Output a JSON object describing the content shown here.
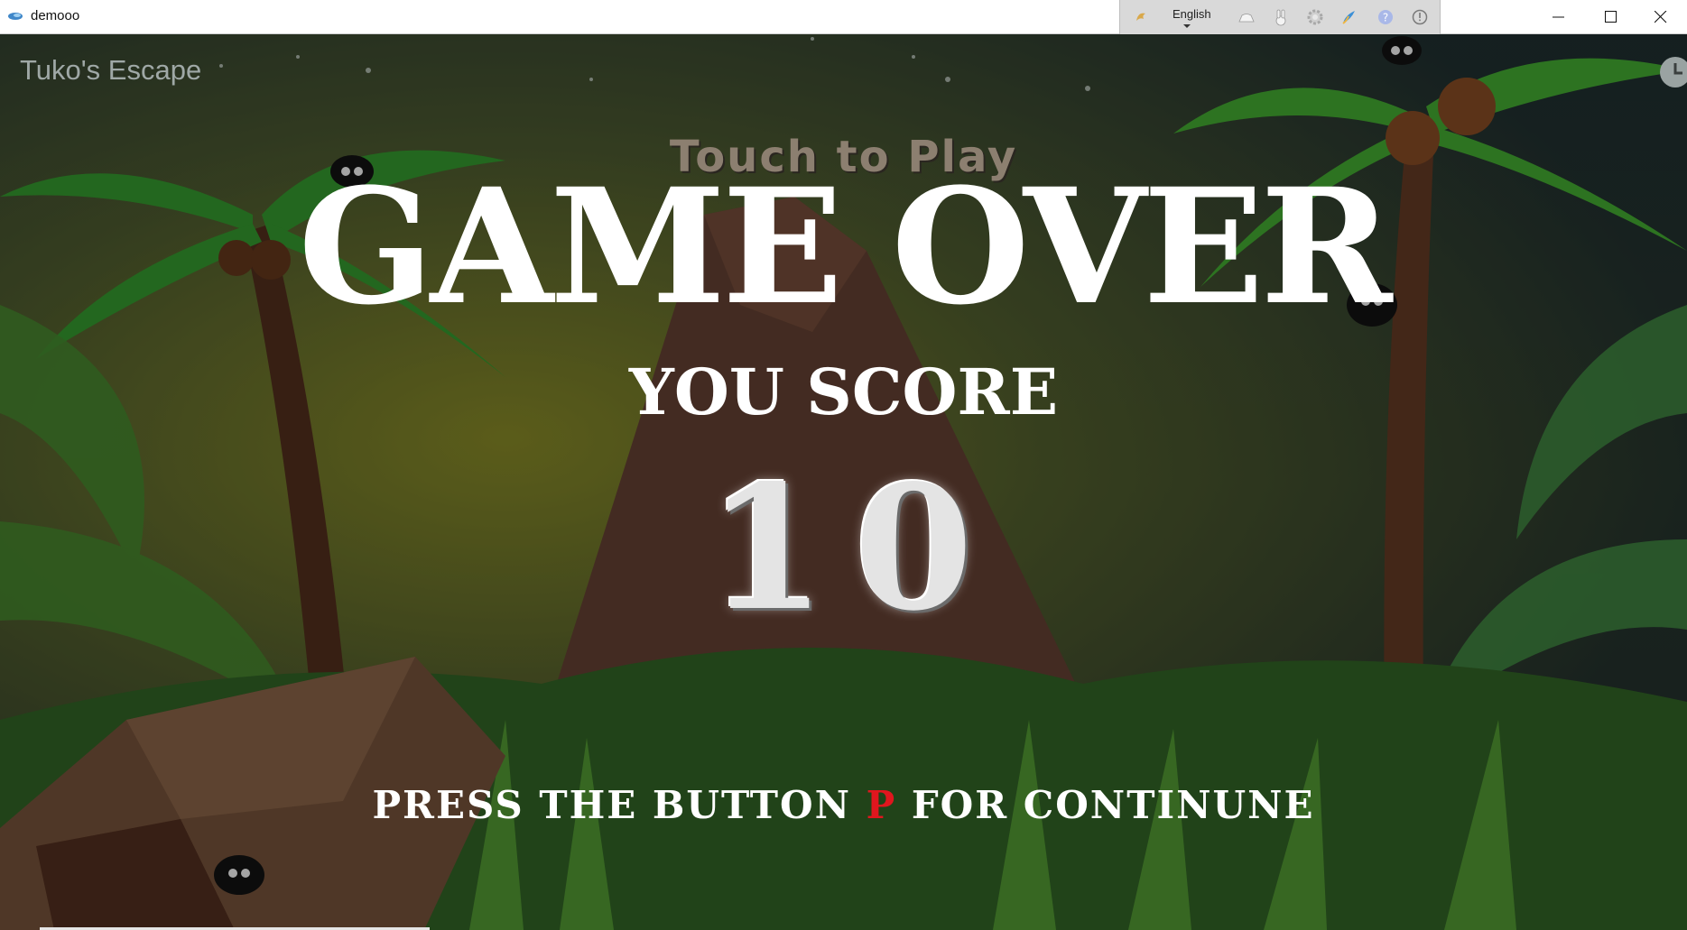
{
  "window": {
    "title": "demooo",
    "minimize_icon": "minimize-icon",
    "maximize_icon": "maximize-icon",
    "close_icon": "close-icon"
  },
  "ime_toolbar": {
    "language": "English",
    "icons": [
      "ime-logo-icon",
      "hat-icon",
      "bunny-icon",
      "gear-icon",
      "paint-icon",
      "help-icon",
      "info-icon"
    ]
  },
  "game": {
    "name": "Tuko's Escape",
    "touch_prompt": "Touch to Play",
    "headline": "GAME OVER",
    "score_label": "YOU SCORE",
    "score_digits": [
      "1",
      "0"
    ],
    "continue_prefix": "PRESS THE BUTTON ",
    "continue_key": "P",
    "continue_suffix": " FOR CONTINUNE"
  },
  "colors": {
    "key_highlight": "#e0161e",
    "headline": "#ffffff",
    "toolbar_bg": "#d9d9d9"
  }
}
